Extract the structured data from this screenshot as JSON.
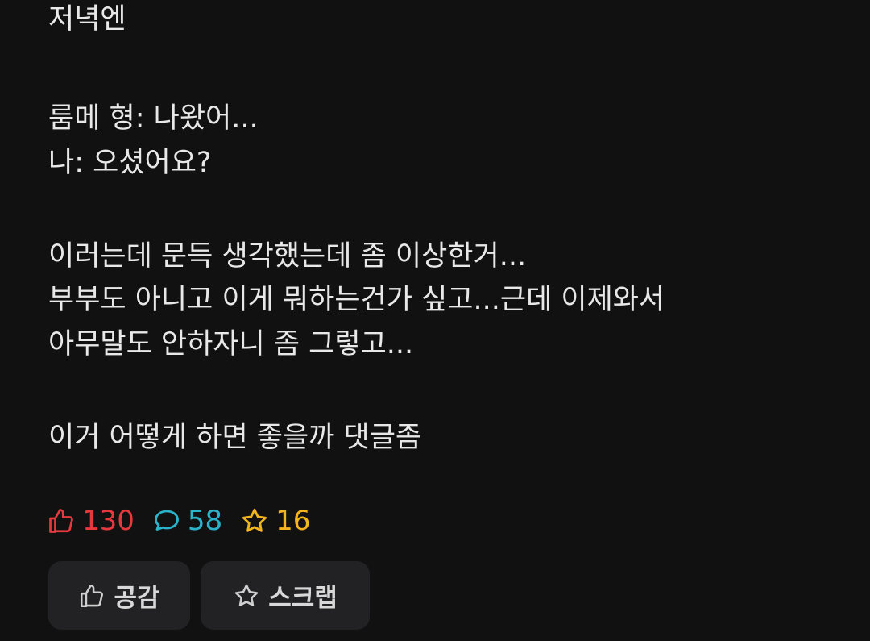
{
  "post": {
    "lines": [
      "저녁엔",
      "룸메 형: 나왔어...",
      "나: 오셨어요?",
      "이러는데 문득 생각했는데 좀 이상한거...",
      "부부도 아니고 이게 뭐하는건가 싶고...근데 이제와서",
      "아무말도 안하자니 좀 그렇고...",
      "이거 어떻게 하면 좋을까 댓글좀"
    ]
  },
  "stats": {
    "likes": "130",
    "comments": "58",
    "scraps": "16"
  },
  "actions": {
    "empathy_label": "공감",
    "scrap_label": "스크랩"
  },
  "colors": {
    "background": "#111112",
    "likes": "#e5393e",
    "comments": "#2bb3c9",
    "scraps": "#f2b51d",
    "button_bg": "#222224"
  },
  "icons": {
    "likes": "thumbs-up-icon",
    "comments": "speech-bubble-icon",
    "scraps": "star-icon"
  }
}
